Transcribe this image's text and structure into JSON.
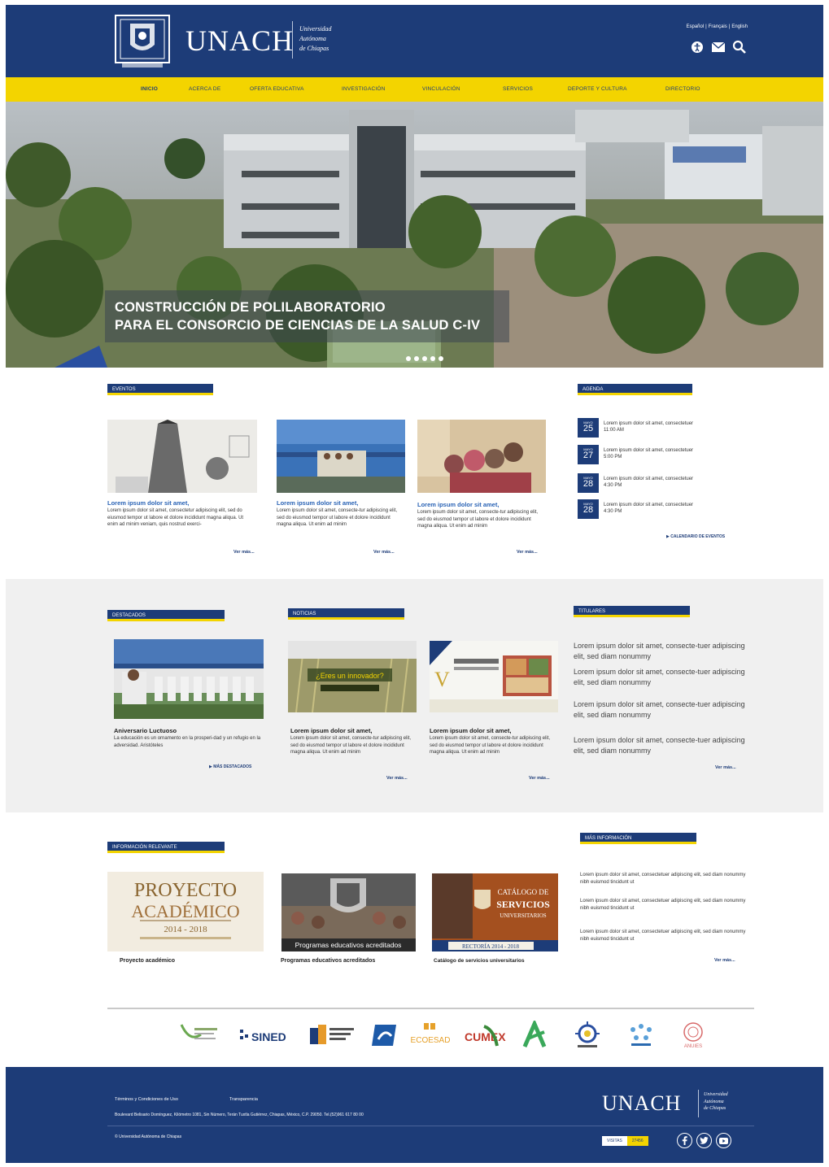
{
  "header": {
    "logo_text": "UNACH",
    "logo_sub": [
      "Universidad",
      "Autónoma",
      "de Chiapas"
    ],
    "languages": [
      "Español",
      "Français",
      "English"
    ],
    "icons": [
      "accessibility-icon",
      "mail-icon",
      "search-icon"
    ]
  },
  "nav": {
    "items": [
      "INICIO",
      "ACERCA DE",
      "OFERTA EDUCATIVA",
      "INVESTIGACIÓN",
      "VINCULACIÓN",
      "SERVICIOS",
      "DEPORTE Y CULTURA",
      "DIRECTORIO"
    ]
  },
  "hero": {
    "caption_line1": "CONSTRUCCIÓN DE POLILABORATORIO",
    "caption_line2": "PARA EL CONSORCIO DE CIENCIAS DE LA SALUD C-IV"
  },
  "eventos": {
    "label": "EVENTOS",
    "cards": [
      {
        "title": "Lorem ipsum dolor sit amet,",
        "text": "Lorem ipsum dolor sit amet, consectetur adipiscing elit, sed do eiusmod tempor ut labore et dolore incididunt magna aliqua. Ut enim ad minim veniam, quis nostrud exerci-",
        "more": "Ver más..."
      },
      {
        "title": "Lorem ipsum dolor sit amet,",
        "text": "Lorem ipsum dolor sit amet, consecte-tur adipiscing elit, sed do eiusmod tempor ut labore et dolore incididunt magna aliqua. Ut enim ad minim",
        "more": "Ver más..."
      },
      {
        "title": "Lorem ipsum dolor sit amet,",
        "text": "Lorem ipsum dolor sit amet, consecte-tur adipiscing elit, sed do eiusmod tempor ut labore et dolore incididunt magna aliqua. Ut enim ad minim",
        "more": "Ver más..."
      }
    ]
  },
  "agenda": {
    "label": "AGENDA",
    "items": [
      {
        "month": "MAYO",
        "day": "25",
        "text": "Lorem ipsum dolor sit amet, consectetuer",
        "time": "11:00 AM"
      },
      {
        "month": "MAYO",
        "day": "27",
        "text": "Lorem ipsum dolor sit amet, consectetuer",
        "time": "5:00 PM"
      },
      {
        "month": "MAYO",
        "day": "28",
        "text": "Lorem ipsum dolor sit amet, consectetuer",
        "time": "4:30 PM"
      },
      {
        "month": "MAYO",
        "day": "28",
        "text": "Lorem ipsum dolor sit amet, consectetuer",
        "time": "4:30 PM"
      }
    ],
    "calendar_link": "CALENDARIO DE EVENTOS"
  },
  "destacados": {
    "label": "DESTACADOS",
    "title": "Aniversario Luctuoso",
    "text": "La educación es un ornamento en la prosperi-dad y un refugio en la adversidad. Aristóteles",
    "more": "MÁS DESTACADOS"
  },
  "noticias": {
    "label": "NOTICIAS",
    "cards": [
      {
        "title": "Lorem ipsum dolor sit amet,",
        "text": "Lorem ipsum dolor sit amet, consecte-tur adipiscing elit, sed do eiusmod tempor ut labore et dolore incididunt magna aliqua. Ut enim ad minim",
        "more": "Ver más...",
        "img_text": "¿Eres un innovador?"
      },
      {
        "title": "Lorem ipsum dolor sit amet,",
        "text": "Lorem ipsum dolor sit amet, consecte-tur adipiscing elit, sed do eiusmod tempor ut labore et dolore incididunt magna aliqua. Ut enim ad minim",
        "more": "Ver más...",
        "img_text": "V"
      }
    ]
  },
  "titulares": {
    "label": "TITULARES",
    "items": [
      "Lorem ipsum dolor sit amet, consecte-tuer adipiscing elit, sed diam nonummy",
      "Lorem ipsum dolor sit amet, consecte-tuer adipiscing elit, sed diam nonummy",
      "Lorem ipsum dolor sit amet, consecte-tuer adipiscing elit, sed diam nonummy",
      "Lorem ipsum dolor sit amet, consecte-tuer adipiscing elit, sed diam nonummy"
    ],
    "more": "Ver más..."
  },
  "relevante": {
    "label": "INFORMACIÓN RELEVANTE",
    "cards": [
      {
        "caption": "Proyecto académico",
        "img_line1": "PROYECTO",
        "img_line2": "ACADÉMICO",
        "img_line3": "2014 - 2018"
      },
      {
        "caption": "Programas educativos acreditados",
        "img_text": "Programas educativos acreditados"
      },
      {
        "caption": "Catálogo de servicios universitarios",
        "img_line1": "CATÁLOGO DE",
        "img_line2": "SERVICIOS",
        "img_line3": "UNIVERSITARIOS",
        "img_footer": "RECTORÍA 2014 - 2018"
      }
    ]
  },
  "mas_info": {
    "label": "MÁS INFORMACIÓN",
    "items": [
      "Lorem ipsum dolor sit amet, consectetuer adipiscing elit, sed diam nonummy nibh euismod tincidunt ut",
      "Lorem ipsum dolor sit amet, consectetuer adipiscing elit, sed diam nonummy nibh euismod tincidunt ut",
      "Lorem ipsum dolor sit amet, consectetuer adipiscing elit, sed diam nonummy nibh euismod tincidunt ut"
    ],
    "more": "Ver más..."
  },
  "partners": [
    "SINED",
    "ECOESAD",
    "CUMEX",
    "ANUIES"
  ],
  "footer": {
    "links": [
      "Términos y Condiciones de Uso",
      "Transparencia"
    ],
    "address": "Boulevard Belisario Domínguez, Kilómetro 1081, Sin Número, Terán Tuxtla Gutiérrez, Chiapas, México, C.P. 29050. Tel.(52)961 617 80 00",
    "copyright": "© Universidad Autónoma de Chiapas",
    "logo_text": "UNACH",
    "logo_sub": [
      "Universidad",
      "Autónoma",
      "de Chiapas"
    ],
    "visits_label": "VISITAS",
    "visits_count": "27456"
  },
  "colors": {
    "brand_blue": "#1d3c78",
    "brand_yellow": "#f3d400",
    "link_blue": "#2a63b5"
  }
}
